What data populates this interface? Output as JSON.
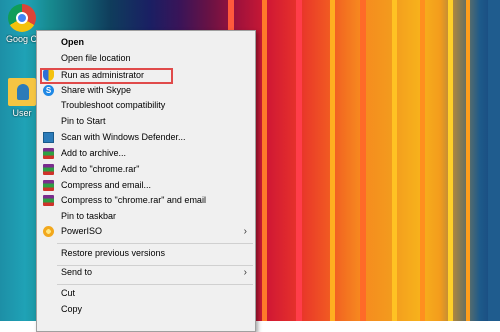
{
  "desktop": {
    "icons": [
      {
        "label": "Goog Chrom",
        "icon": "chrome-icon"
      },
      {
        "label": "User",
        "icon": "user-folder-icon"
      }
    ]
  },
  "context_menu": {
    "items": [
      {
        "label": "Open",
        "bold": true,
        "icon": null
      },
      {
        "label": "Open file location",
        "icon": null
      },
      {
        "label": "Run as administrator",
        "icon": "uac-shield-icon",
        "highlighted": true
      },
      {
        "label": "Share with Skype",
        "icon": "skype-icon"
      },
      {
        "label": "Troubleshoot compatibility",
        "icon": null
      },
      {
        "label": "Pin to Start",
        "icon": null
      },
      {
        "label": "Scan with Windows Defender...",
        "icon": "windows-defender-icon"
      },
      {
        "label": "Add to archive...",
        "icon": "winrar-icon"
      },
      {
        "label": "Add to \"chrome.rar\"",
        "icon": "winrar-icon"
      },
      {
        "label": "Compress and email...",
        "icon": "winrar-icon"
      },
      {
        "label": "Compress to \"chrome.rar\" and email",
        "icon": "winrar-icon"
      },
      {
        "label": "Pin to taskbar",
        "icon": null
      },
      {
        "label": "PowerISO",
        "icon": "poweriso-icon",
        "submenu": true
      },
      {
        "label": "Restore previous versions",
        "icon": null
      },
      {
        "label": "Send to",
        "icon": null,
        "submenu": true
      },
      {
        "label": "Cut",
        "icon": null
      },
      {
        "label": "Copy",
        "icon": null
      }
    ],
    "submenu_arrow": "›"
  },
  "colors": {
    "highlight_box": "#e04a4a",
    "menu_bg": "#f0f0f0"
  }
}
